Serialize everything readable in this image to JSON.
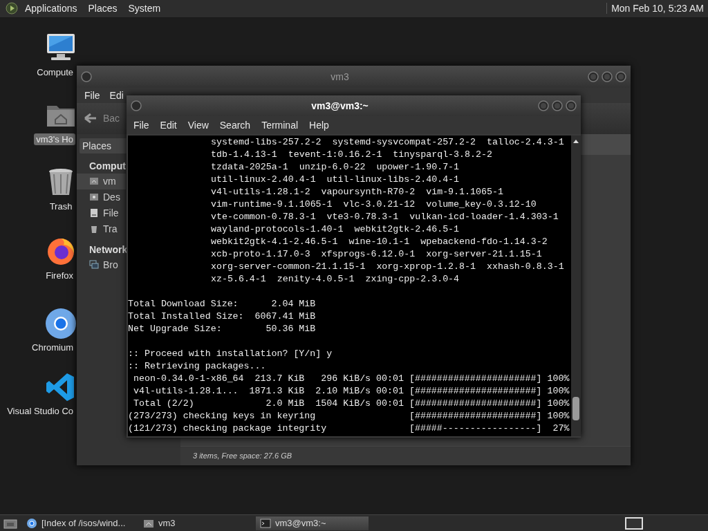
{
  "top_panel": {
    "menus": [
      "Applications",
      "Places",
      "System"
    ],
    "clock": "Mon Feb 10, 5:23 AM"
  },
  "desktop_icons": [
    {
      "label": "Compute",
      "selected": false
    },
    {
      "label": "vm3's Ho",
      "selected": true
    },
    {
      "label": "Trash",
      "selected": false
    },
    {
      "label": "Firefox",
      "selected": false
    },
    {
      "label": "Chromium",
      "selected": false
    },
    {
      "label": "Visual Studio Co",
      "selected": false
    }
  ],
  "file_manager": {
    "title": "vm3",
    "menus": [
      "File",
      "Edi"
    ],
    "back": "Bac",
    "places_button": "Places",
    "sidebar": [
      {
        "header": "Comput",
        "items": [
          {
            "label": "vm",
            "selected": true
          },
          {
            "label": "Des",
            "selected": false
          },
          {
            "label": "File",
            "selected": false
          },
          {
            "label": "Tra",
            "selected": false
          }
        ]
      },
      {
        "header": "Network",
        "items": [
          {
            "label": "Bro",
            "selected": false
          }
        ]
      }
    ],
    "status_bar": "3 items, Free space: 27.6 GB"
  },
  "terminal": {
    "title": "vm3@vm3:~",
    "menus": [
      "File",
      "Edit",
      "View",
      "Search",
      "Terminal",
      "Help"
    ],
    "sections": [
      {
        "kind": "packages",
        "lines": [
          "systemd-libs-257.2-2  systemd-sysvcompat-257.2-2  talloc-2.4.3-1",
          "tdb-1.4.13-1  tevent-1:0.16.2-1  tinysparql-3.8.2-2",
          "tzdata-2025a-1  unzip-6.0-22  upower-1.90.7-1",
          "util-linux-2.40.4-1  util-linux-libs-2.40.4-1",
          "v4l-utils-1.28.1-2  vapoursynth-R70-2  vim-9.1.1065-1",
          "vim-runtime-9.1.1065-1  vlc-3.0.21-12  volume_key-0.3.12-10",
          "vte-common-0.78.3-1  vte3-0.78.3-1  vulkan-icd-loader-1.4.303-1",
          "wayland-protocols-1.40-1  webkit2gtk-2.46.5-1",
          "webkit2gtk-4.1-2.46.5-1  wine-10.1-1  wpebackend-fdo-1.14.3-2",
          "xcb-proto-1.17.0-3  xfsprogs-6.12.0-1  xorg-server-21.1.15-1",
          "xorg-server-common-21.1.15-1  xorg-xprop-1.2.8-1  xxhash-0.8.3-1",
          "xz-5.6.4-1  zenity-4.0.5-1  zxing-cpp-2.3.0-4"
        ]
      },
      {
        "kind": "plain",
        "lines": [
          "Total Download Size:      2.04 MiB",
          "Total Installed Size:  6067.41 MiB",
          "Net Upgrade Size:        50.36 MiB"
        ]
      },
      {
        "kind": "plain",
        "lines": [
          ":: Proceed with installation? [Y/n] y",
          ":: Retrieving packages...",
          " neon-0.34.0-1-x86_64  213.7 KiB   296 KiB/s 00:01 [######################] 100%",
          " v4l-utils-1.28.1...  1871.3 KiB  2.10 MiB/s 00:01 [######################] 100%",
          " Total (2/2)             2.0 MiB  1504 KiB/s 00:01 [######################] 100%",
          "(273/273) checking keys in keyring                 [######################] 100%",
          "(121/273) checking package integrity               [#####-----------------]  27%"
        ]
      }
    ]
  },
  "taskbar": [
    {
      "label": "[Index of /isos/wind...",
      "selected": false
    },
    {
      "label": "vm3",
      "selected": false
    },
    {
      "label": "vm3@vm3:~",
      "selected": true
    }
  ]
}
